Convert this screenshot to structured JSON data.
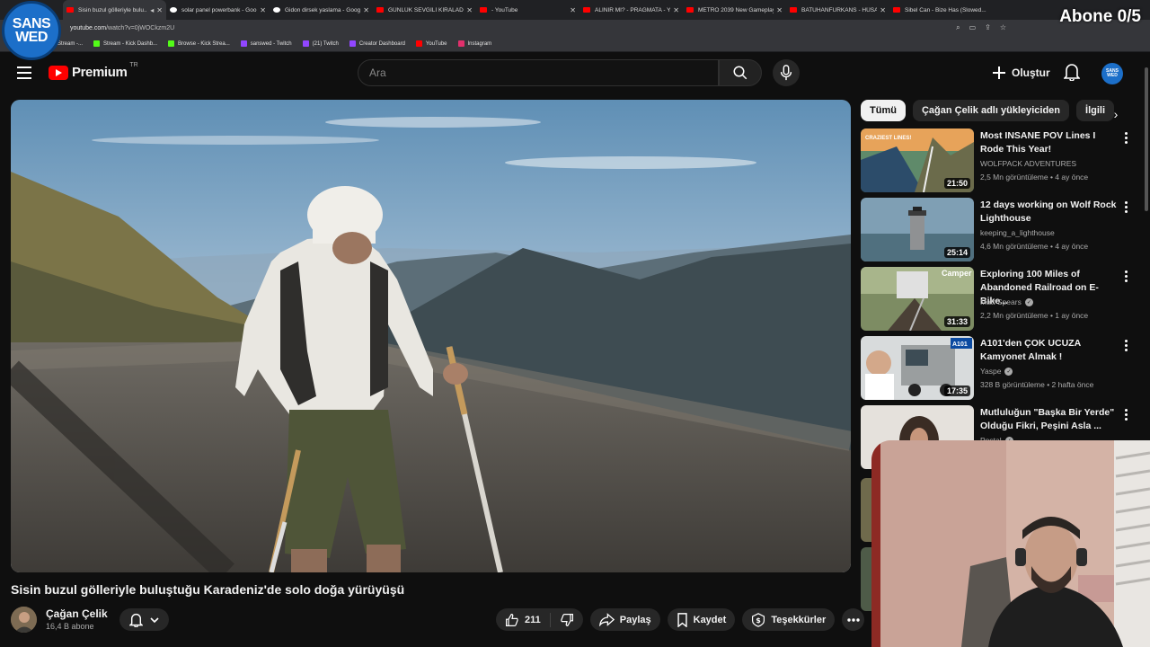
{
  "browser": {
    "tabs": [
      {
        "title": "Sisin buzul gölleriyle bulu...",
        "fav": "youtube"
      },
      {
        "title": "solar panel powerbank - Goo...",
        "fav": "google"
      },
      {
        "title": "Gidon dirsek yaslama - Googl...",
        "fav": "google"
      },
      {
        "title": "GÜNLÜK SEVGİLİ KİRALADIM...",
        "fav": "youtube"
      },
      {
        "title": "- YouTube",
        "fav": "youtube"
      },
      {
        "title": "ALINIR MI? - PRAGMATA - Yo...",
        "fav": "youtube"
      },
      {
        "title": "METRO 2039 New Gameplay...",
        "fav": "youtube"
      },
      {
        "title": "BATUHANFURKANS - HÜSAM...",
        "fav": "youtube"
      },
      {
        "title": "Sibel Can - Bize Has (Slowed...",
        "fav": "youtube"
      }
    ],
    "url_prefix": "youtube.com",
    "url_rest": "/watch?v=0jWOCkzm2U",
    "bookmarks": [
      {
        "label": "Stream -...",
        "color": "#53fc18"
      },
      {
        "label": "Stream - Kick Dashb...",
        "color": "#53fc18"
      },
      {
        "label": "Browse - Kick Strea...",
        "color": "#53fc18"
      },
      {
        "label": "sanswed - Twitch",
        "color": "#9146ff"
      },
      {
        "label": "(21) Twitch",
        "color": "#9146ff"
      },
      {
        "label": "Creator Dashboard",
        "color": "#9146ff"
      },
      {
        "label": "YouTube",
        "color": "#ff0000"
      },
      {
        "label": "Instagram",
        "color": "#e1306c"
      }
    ]
  },
  "overlay": {
    "logo_line1": "SANS",
    "logo_line2": "WED",
    "subscriber_goal": "Abone 0/5"
  },
  "header": {
    "logo_text": "Premium",
    "region": "TR",
    "search_placeholder": "Ara",
    "create_label": "Oluştur",
    "avatar_line1": "SANS",
    "avatar_line2": "WED"
  },
  "video": {
    "title": "Sisin buzul gölleriyle buluştuğu Karadeniz'de solo doğa yürüyüşü",
    "channel": "Çağan Çelik",
    "subscribers": "16,4 B abone",
    "likes": "211",
    "share_label": "Paylaş",
    "save_label": "Kaydet",
    "thanks_label": "Teşekkürler"
  },
  "chips": [
    "Tümü",
    "Çağan Çelik adlı yükleyiciden",
    "İlgili"
  ],
  "recommendations": [
    {
      "title": "Most INSANE POV Lines I Rode This Year!",
      "channel": "WOLFPACK ADVENTURES",
      "verified": false,
      "meta": "2,5 Mn görüntüleme • 4 ay önce",
      "duration": "21:50",
      "thumb_text": "CRAZIEST LINES!"
    },
    {
      "title": "12 days working on Wolf Rock Lighthouse",
      "channel": "keeping_a_lighthouse",
      "verified": false,
      "meta": "4,6 Mn görüntüleme • 4 ay önce",
      "duration": "25:14",
      "thumb_text": ""
    },
    {
      "title": "Exploring 100 Miles of Abandoned Railroad on E-Bike...",
      "channel": "Matt Spears",
      "verified": true,
      "meta": "2,2 Mn görüntüleme • 1 ay önce",
      "duration": "31:33",
      "thumb_text": "Camper"
    },
    {
      "title": "A101'den ÇOK UCUZA Kamyonet Almak !",
      "channel": "Yaspe",
      "verified": true,
      "meta": "328 B görüntüleme • 2 hafta önce",
      "duration": "17:35",
      "thumb_text": "A101"
    },
    {
      "title": "Mutluluğun \"Başka Bir Yerde\" Olduğu Fikri, Peşini Asla ...",
      "channel": "Postal",
      "verified": true,
      "meta": "",
      "duration": "",
      "thumb_text": ""
    }
  ]
}
